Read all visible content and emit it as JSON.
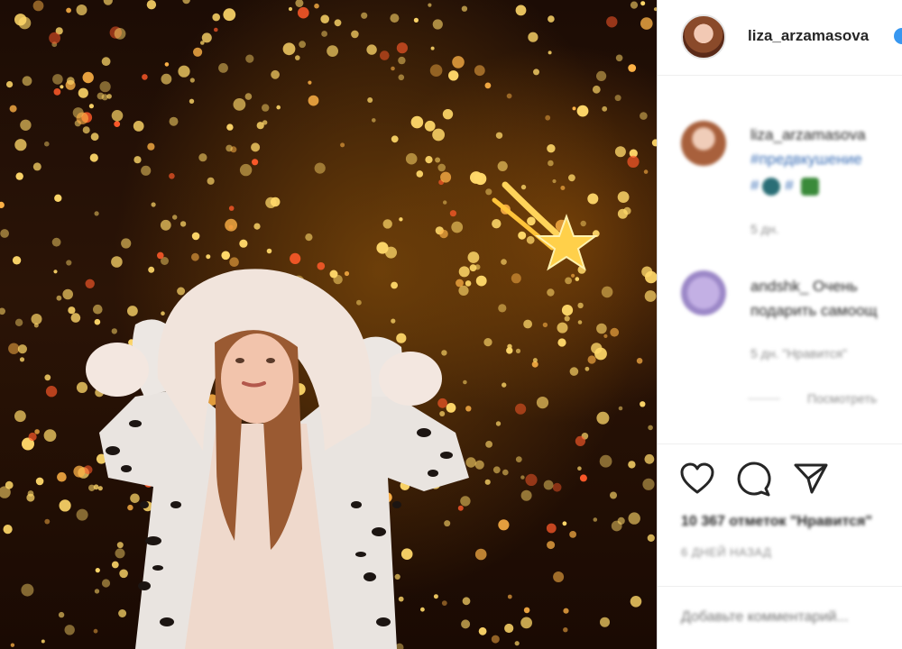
{
  "post": {
    "username": "liza_arzamasova",
    "actions": {
      "like_icon": "heart-icon",
      "comment_icon": "comment-icon",
      "share_icon": "share-icon"
    },
    "likes": "10 367 отметок \"Нравится\"",
    "time": "6 ДНЕЙ НАЗАД",
    "add_comment_placeholder": "Добавьте комментарий..."
  },
  "comments": [
    {
      "username": "liza_arzamasova",
      "text_line1": "liza_arzamasova",
      "text_line2": "#предвкушение",
      "text_line3": "#",
      "meta": "5 дн."
    },
    {
      "username": "andshk_",
      "text_line1": "andshk_ Очень",
      "text_line2": "подарить самоощ",
      "meta": "5 дн.   \"Нравится\"",
      "replies": "Посмотреть"
    }
  ],
  "colors": {
    "verified": "#3897f0",
    "link": "#3b6fb6",
    "muted": "#8e8e8e"
  }
}
